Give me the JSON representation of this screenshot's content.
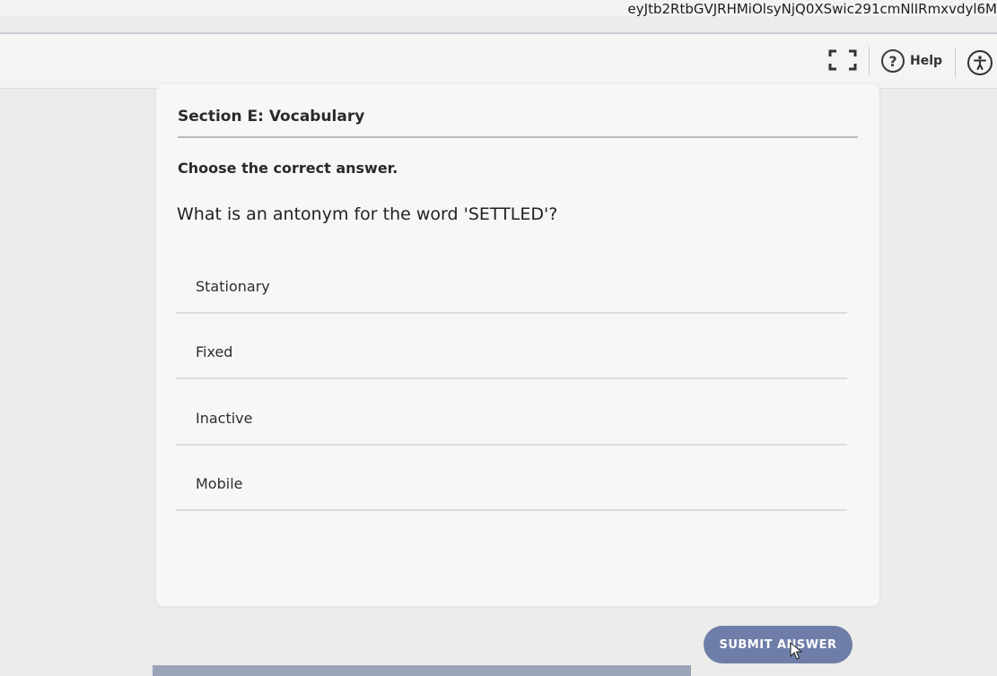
{
  "browser": {
    "url_fragment": "eyJtb2RtbGVJRHMiOlsyNjQ0XSwic291cmNlIRmxvdyl6M"
  },
  "toolbar": {
    "help_label": "Help",
    "icons": [
      "fullscreen-icon",
      "help-icon",
      "accessibility-icon"
    ]
  },
  "section": {
    "title": "Section E: Vocabulary",
    "instruction": "Choose the correct answer."
  },
  "question": {
    "text": "What is an antonym for the word 'SETTLED'?",
    "options": [
      {
        "label": "Stationary"
      },
      {
        "label": "Fixed"
      },
      {
        "label": "Inactive"
      },
      {
        "label": "Mobile"
      }
    ]
  },
  "actions": {
    "submit_label": "SUBMIT ANSWER"
  },
  "colors": {
    "submit_bg": "#6f7ea8",
    "card_bg": "#f7f7f5",
    "page_bg": "#ececea"
  }
}
